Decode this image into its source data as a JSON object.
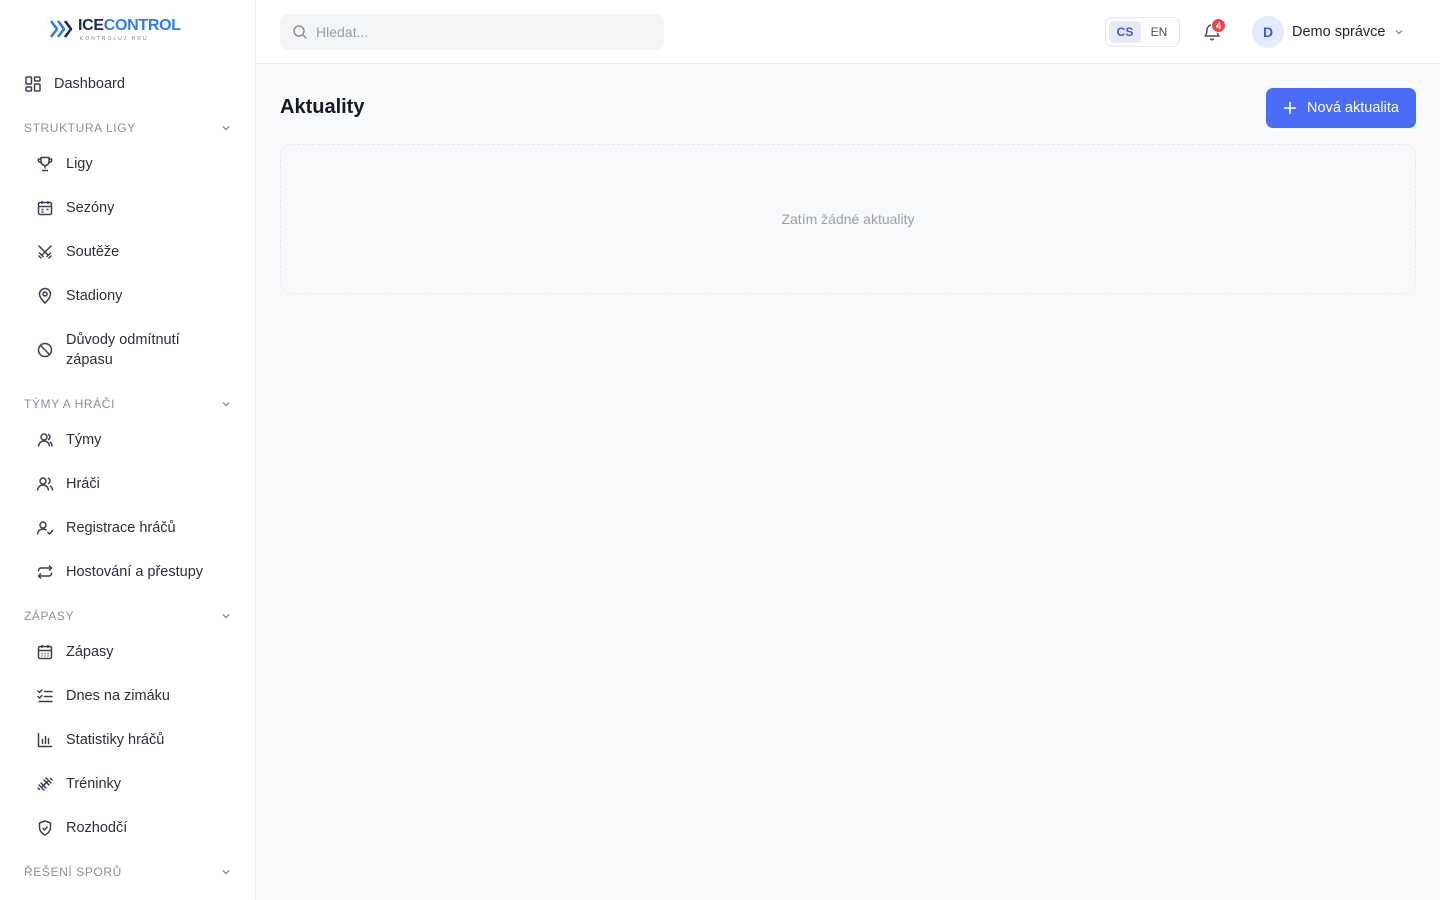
{
  "brand": {
    "name_part1": "ICE",
    "name_part2": "CONTROL",
    "tagline": "KONTROLUJ HRU"
  },
  "sidebar": {
    "dashboard": "Dashboard",
    "sections": [
      {
        "title": "Struktura ligy",
        "items": [
          "Ligy",
          "Sezóny",
          "Soutěže",
          "Stadiony",
          "Důvody odmítnutí zápasu"
        ]
      },
      {
        "title": "Týmy a hráči",
        "items": [
          "Týmy",
          "Hráči",
          "Registrace hráčů",
          "Hostování a přestupy"
        ]
      },
      {
        "title": "Zápasy",
        "items": [
          "Zápasy",
          "Dnes na zimáku",
          "Statistiky hráčů",
          "Tréninky",
          "Rozhodčí"
        ]
      },
      {
        "title": "Řešení sporů",
        "items": []
      }
    ]
  },
  "topbar": {
    "search_placeholder": "Hledat...",
    "search_value": "",
    "languages": [
      "CS",
      "EN"
    ],
    "active_language": "CS",
    "notification_count": "4",
    "user": {
      "initial": "D",
      "name": "Demo správce"
    }
  },
  "main": {
    "title": "Aktuality",
    "new_button": "Nová aktualita",
    "empty_message": "Zatím žádné aktuality"
  },
  "colors": {
    "accent": "#4a6cf7",
    "badge": "#e5484d",
    "brand_dark": "#1b2a55",
    "brand_blue": "#2f7fe6"
  },
  "icons": {
    "dashboard": "dashboard-grid-icon",
    "ligy": "trophy-icon",
    "sezony": "calendar-icon",
    "souteze": "swords-icon",
    "stadiony": "map-pin-icon",
    "duvody": "ban-icon",
    "tymy": "user-icon",
    "hraci": "users-icon",
    "registrace": "user-check-icon",
    "hostovani": "transfer-arrows-icon",
    "zapasy": "calendar-grid-icon",
    "dnes": "checklist-icon",
    "statistiky": "bar-chart-icon",
    "treninky": "dumbbell-icon",
    "rozhodci": "shield-check-icon"
  }
}
